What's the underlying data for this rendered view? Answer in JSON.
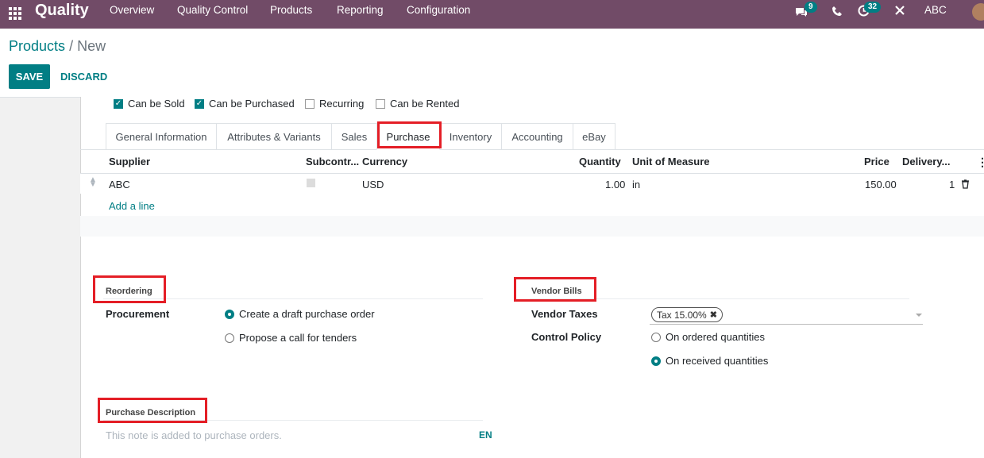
{
  "navbar": {
    "app_name": "Quality",
    "menu": [
      "Overview",
      "Quality Control",
      "Products",
      "Reporting",
      "Configuration"
    ],
    "messages_badge": "9",
    "activities_badge": "32",
    "company": "ABC"
  },
  "breadcrumb": {
    "parent": "Products",
    "separator": "/",
    "current": "New"
  },
  "buttons": {
    "save": "SAVE",
    "discard": "DISCARD"
  },
  "checkboxes": [
    {
      "label": "Can be Sold",
      "checked": true
    },
    {
      "label": "Can be Purchased",
      "checked": true
    },
    {
      "label": "Recurring",
      "checked": false
    },
    {
      "label": "Can be Rented",
      "checked": false
    }
  ],
  "tabs": [
    "General Information",
    "Attributes & Variants",
    "Sales",
    "Purchase",
    "Inventory",
    "Accounting",
    "eBay"
  ],
  "active_tab": "Purchase",
  "vendor_table": {
    "columns": [
      "Supplier",
      "Subcontr...",
      "Currency",
      "Quantity",
      "Unit of Measure",
      "Price",
      "Delivery..."
    ],
    "rows": [
      {
        "supplier": "ABC",
        "subcontract": false,
        "currency": "USD",
        "quantity": "1.00",
        "uom": "in",
        "price": "150.00",
        "delivery": "1"
      }
    ],
    "add_line": "Add a line"
  },
  "reordering": {
    "title": "Reordering",
    "procurement_label": "Procurement",
    "options": [
      {
        "label": "Create a draft purchase order",
        "selected": true
      },
      {
        "label": "Propose a call for tenders",
        "selected": false
      }
    ]
  },
  "vendor_bills": {
    "title": "Vendor Bills",
    "taxes_label": "Vendor Taxes",
    "tax_tag": "Tax 15.00%",
    "control_policy_label": "Control Policy",
    "options": [
      {
        "label": "On ordered quantities",
        "selected": false
      },
      {
        "label": "On received quantities",
        "selected": true
      }
    ]
  },
  "purchase_description": {
    "title": "Purchase Description",
    "placeholder": "This note is added to purchase orders.",
    "lang": "EN"
  },
  "colors": {
    "navbar": "#714b67",
    "accent": "#017e84",
    "highlight": "#e41e26"
  }
}
